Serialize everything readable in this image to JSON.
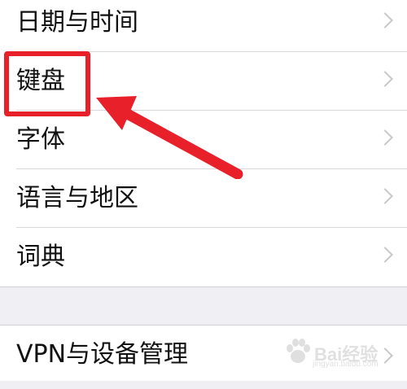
{
  "settings_group_1": {
    "items": [
      {
        "label": "日期与时间"
      },
      {
        "label": "键盘"
      },
      {
        "label": "字体"
      },
      {
        "label": "语言与地区"
      },
      {
        "label": "词典"
      }
    ]
  },
  "settings_group_2": {
    "items": [
      {
        "label": "VPN与设备管理"
      }
    ]
  },
  "annotation": {
    "color": "#e8202a",
    "target": "键盘"
  },
  "watermark": {
    "text": "Bai经验",
    "url": "jingyan.baidu.com"
  },
  "icons": {
    "chevron": "chevron-right-icon",
    "arrow": "annotation-arrow-icon",
    "watermark_logo": "baidu-paw-icon"
  }
}
